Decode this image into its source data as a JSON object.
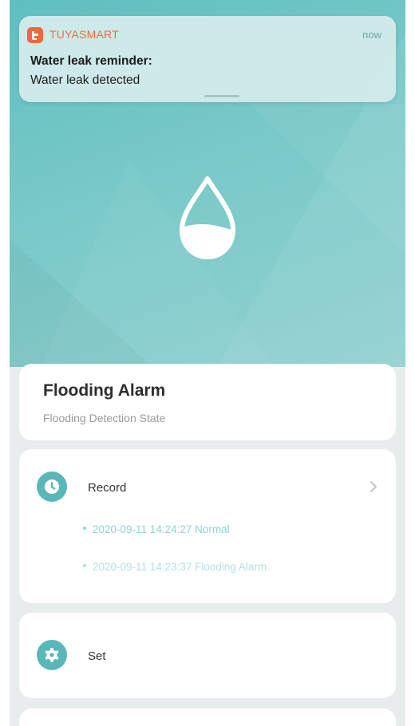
{
  "notification": {
    "app_name": "TUYASMART",
    "time": "now",
    "title": "Water leak reminder:",
    "body": "Water leak detected",
    "app_icon": "tuya-logo-icon"
  },
  "hero": {
    "icon": "water-drop-icon"
  },
  "status_card": {
    "title": "Flooding Alarm",
    "subtitle": "Flooding Detection State"
  },
  "record_card": {
    "label": "Record",
    "icon": "clock-icon",
    "chevron_icon": "chevron-right-icon",
    "entries": [
      "2020-09-11 14:24:27 Normal",
      "2020-09-11 14:23:37 Flooding Alarm"
    ]
  },
  "set_card": {
    "label": "Set",
    "icon": "gear-icon"
  },
  "colors": {
    "accent": "#59b7b8",
    "hero_background": "#79c9c8",
    "app_brand": "#f0663f",
    "record_text": "#8fd3d2"
  }
}
